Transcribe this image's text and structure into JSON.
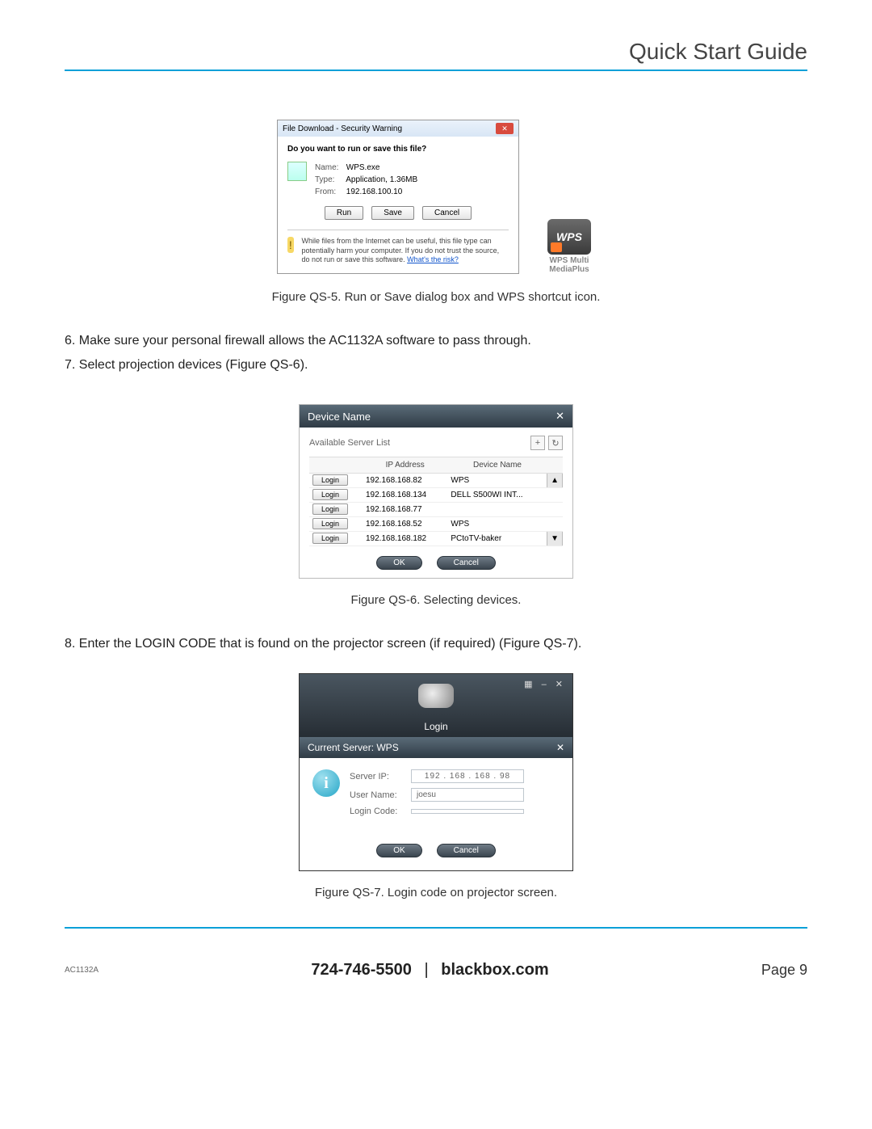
{
  "header": {
    "title": "Quick Start Guide"
  },
  "dialog1": {
    "titlebar": "File Download - Security Warning",
    "question": "Do you want to run or save this file?",
    "name_label": "Name:",
    "name_value": "WPS.exe",
    "type_label": "Type:",
    "type_value": "Application, 1.36MB",
    "from_label": "From:",
    "from_value": "192.168.100.10",
    "run": "Run",
    "save": "Save",
    "cancel": "Cancel",
    "warn_text": "While files from the Internet can be useful, this file type can potentially harm your computer. If you do not trust the source, do not run or save this software. ",
    "warn_link": "What's the risk?"
  },
  "wps_icon": {
    "badge": "WPS",
    "line1": "WPS Multi",
    "line2": "MediaPlus"
  },
  "caption1": "Figure QS-5. Run or Save dialog box and WPS shortcut icon.",
  "body": {
    "step6": "6. Make sure your personal firewall allows the AC1132A software to pass through.",
    "step7": "7. Select projection devices (Figure QS-6).",
    "step8": "8. Enter the LOGIN CODE that is found on the projector screen (if required) (Figure QS-7)."
  },
  "fig2": {
    "title": "Device Name",
    "subtitle": "Available Server List",
    "col_login": "",
    "col_ip": "IP Address",
    "col_name": "Device Name",
    "rows": [
      {
        "ip": "192.168.168.82",
        "name": "WPS"
      },
      {
        "ip": "192.168.168.134",
        "name": "DELL S500WI INT..."
      },
      {
        "ip": "192.168.168.77",
        "name": ""
      },
      {
        "ip": "192.168.168.52",
        "name": "WPS"
      },
      {
        "ip": "192.168.168.182",
        "name": "PCtoTV-baker"
      }
    ],
    "login_btn": "Login",
    "ok": "OK",
    "cancel": "Cancel"
  },
  "caption2": "Figure QS-6. Selecting devices.",
  "fig3": {
    "login_word": "Login",
    "bar": "Current Server: WPS",
    "server_ip_label": "Server IP:",
    "server_ip_value": "192  .  168  .  168  .  98",
    "user_label": "User Name:",
    "user_value": "joesu",
    "code_label": "Login Code:",
    "code_value": "",
    "ok": "OK",
    "cancel": "Cancel"
  },
  "caption3": "Figure QS-7. Login code on projector screen.",
  "footer": {
    "left": "AC1132A",
    "phone": "724-746-5500",
    "site": "blackbox.com",
    "sep": "|",
    "page": "Page 9"
  }
}
